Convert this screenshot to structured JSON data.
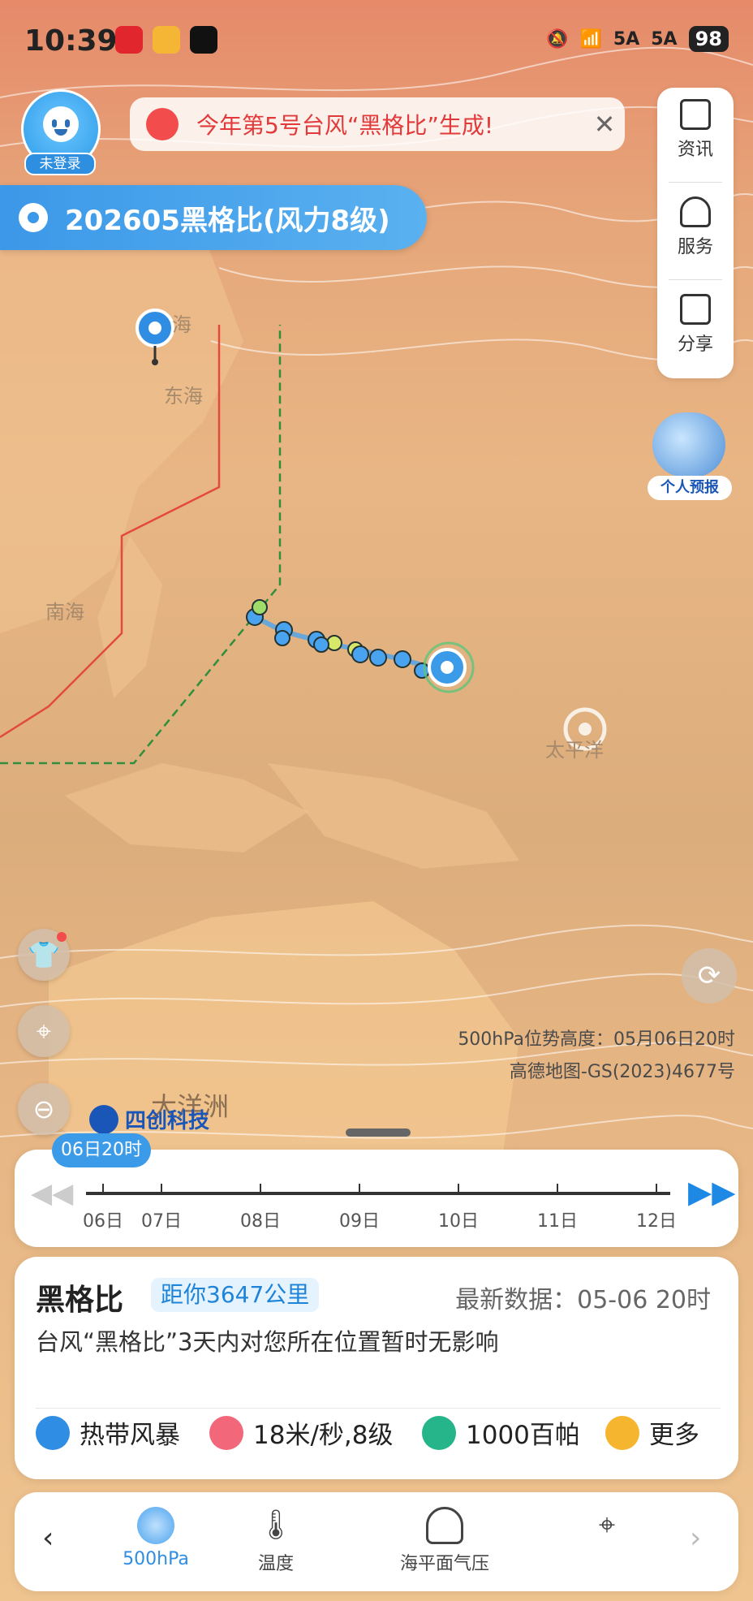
{
  "status_bar": {
    "time": "10:39",
    "signal1": "5A",
    "signal2": "5A",
    "battery": "98"
  },
  "user": {
    "login_label": "未登录"
  },
  "notice": {
    "text": "今年第5号台风“黑格比”生成!"
  },
  "storm_tag": {
    "label": "202605黑格比(风力8级)"
  },
  "right_panel": {
    "items": [
      {
        "label": "资讯",
        "icon": "news-icon"
      },
      {
        "label": "服务",
        "icon": "service-icon"
      },
      {
        "label": "分享",
        "icon": "share-icon"
      }
    ]
  },
  "forecast_widget": {
    "label": "个人预报"
  },
  "map": {
    "labels": [
      "海",
      "东海",
      "南海",
      "太平洋",
      "大洋洲"
    ],
    "layer_info": "500hPa位势高度：05月06日20时",
    "copyright": "高德地图-GS(2023)4677号",
    "brand": "四创科技",
    "colors": {
      "storm_track": "#4aa3ef",
      "warning_line_24h": "#e24a3b",
      "warning_line_48h": "#2f8f3a"
    }
  },
  "timeline": {
    "current": "06日20时",
    "days": [
      "06日",
      "07日",
      "08日",
      "09日",
      "10日",
      "11日",
      "12日"
    ]
  },
  "storm_card": {
    "name": "黑格比",
    "distance": "距你3647公里",
    "latest": "最新数据：05-06 20时",
    "impact": "台风“黑格比”3天内对您所在位置暂时无影响",
    "stats": [
      {
        "label": "热带风暴",
        "icon": "storm-icon",
        "color": "#2f8de4"
      },
      {
        "label": "18米/秒,8级",
        "icon": "wind-icon",
        "color": "#f2687a"
      },
      {
        "label": "1000百帕",
        "icon": "pressure-icon",
        "color": "#26b58a"
      },
      {
        "label": "更多",
        "icon": "more-icon",
        "color": "#f5b52f"
      }
    ]
  },
  "bottom_nav": {
    "items": [
      {
        "label": "500hPa",
        "active": true
      },
      {
        "label": "温度",
        "active": false
      },
      {
        "label": "海平面气压",
        "active": false
      },
      {
        "label": "",
        "active": false
      }
    ]
  }
}
